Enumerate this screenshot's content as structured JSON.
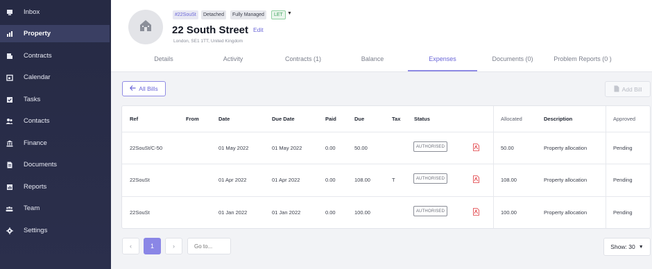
{
  "sidebar": {
    "items": [
      {
        "label": "Inbox",
        "icon": "inbox-icon"
      },
      {
        "label": "Property",
        "icon": "property-chart-icon",
        "active": true
      },
      {
        "label": "Contracts",
        "icon": "contracts-icon"
      },
      {
        "label": "Calendar",
        "icon": "calendar-icon"
      },
      {
        "label": "Tasks",
        "icon": "tasks-check-icon"
      },
      {
        "label": "Contacts",
        "icon": "contacts-people-icon"
      },
      {
        "label": "Finance",
        "icon": "finance-bank-icon"
      },
      {
        "label": "Documents",
        "icon": "document-icon"
      },
      {
        "label": "Reports",
        "icon": "reports-icon"
      },
      {
        "label": "Team",
        "icon": "team-icon"
      },
      {
        "label": "Settings",
        "icon": "gear-icon"
      }
    ]
  },
  "property": {
    "ref_tag": "#22SouSt",
    "tags": [
      "Detached",
      "Fully Managed"
    ],
    "status_tag": "LET",
    "title": "22 South Street",
    "edit_label": "Edit",
    "address": "London, SE1 1TT, United Kingdom"
  },
  "tabs": [
    {
      "label": "Details"
    },
    {
      "label": "Activity"
    },
    {
      "label": "Contracts (1)"
    },
    {
      "label": "Balance"
    },
    {
      "label": "Expenses",
      "active": true
    },
    {
      "label": "Documents (0)"
    },
    {
      "label": "Problem Reports (0 )"
    }
  ],
  "toolbar": {
    "all_bills_label": "All Bills",
    "add_bill_label": "Add Bill"
  },
  "table": {
    "columns": [
      "Ref",
      "From",
      "Date",
      "Due Date",
      "Paid",
      "Due",
      "Tax",
      "Status",
      "Allocated",
      "Description",
      "Approved"
    ],
    "rows": [
      {
        "ref": "22SouSt/C-50",
        "from": "",
        "date": "01 May 2022",
        "due_date": "01 May 2022",
        "paid": "0.00",
        "due": "50.00",
        "tax": "",
        "status": "AUTHORISED",
        "allocated": "50.00",
        "description": "Property allocation",
        "approved": "Pending"
      },
      {
        "ref": "22SouSt",
        "from": "",
        "date": "01 Apr 2022",
        "due_date": "01 Apr 2022",
        "paid": "0.00",
        "due": "108.00",
        "tax": "T",
        "status": "AUTHORISED",
        "allocated": "108.00",
        "description": "Property allocation",
        "approved": "Pending"
      },
      {
        "ref": "22SouSt",
        "from": "",
        "date": "01 Jan 2022",
        "due_date": "01 Jan 2022",
        "paid": "0.00",
        "due": "100.00",
        "tax": "",
        "status": "AUTHORISED",
        "allocated": "100.00",
        "description": "Property allocation",
        "approved": "Pending"
      }
    ]
  },
  "pagination": {
    "prev": "‹",
    "current_page": "1",
    "next": "›",
    "goto_placeholder": "Go to...",
    "show_label": "Show: 30"
  },
  "colors": {
    "sidebar_bg": "#262a44",
    "accent": "#6a66d8",
    "active_page": "#8a86e6",
    "pdf_red": "#e0393e"
  }
}
